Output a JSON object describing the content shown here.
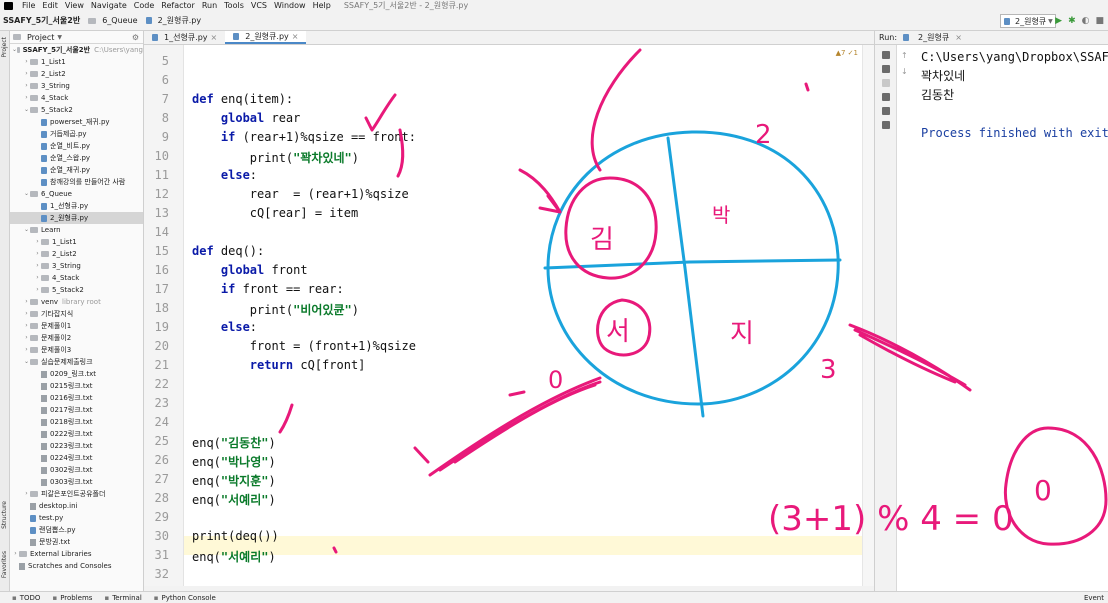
{
  "menubar": {
    "items": [
      "File",
      "Edit",
      "View",
      "Navigate",
      "Code",
      "Refactor",
      "Run",
      "Tools",
      "VCS",
      "Window",
      "Help"
    ],
    "title": "SSAFY_5기_서울2반 - 2_원형큐.py"
  },
  "navbar": {
    "crumbs": [
      "SSAFY_5기_서울2반",
      "6_Queue",
      "2_원형큐.py"
    ],
    "run_config": "2_원형큐"
  },
  "project": {
    "header": "Project",
    "root_name": "SSAFY_5기_서울2반",
    "root_path": "C:\\Users\\yang",
    "rows": [
      {
        "indent": 0,
        "type": "root",
        "label": "SSAFY_5기_서울2반",
        "extra": "C:\\Users\\yang"
      },
      {
        "indent": 1,
        "type": "folder",
        "label": "1_List1"
      },
      {
        "indent": 1,
        "type": "folder",
        "label": "2_List2"
      },
      {
        "indent": 1,
        "type": "folder",
        "label": "3_String"
      },
      {
        "indent": 1,
        "type": "folder",
        "label": "4_Stack"
      },
      {
        "indent": 1,
        "type": "folder-open",
        "label": "5_Stack2"
      },
      {
        "indent": 2,
        "type": "file",
        "label": "powerset_재귀.py"
      },
      {
        "indent": 2,
        "type": "file",
        "label": "거듭제곱.py"
      },
      {
        "indent": 2,
        "type": "file",
        "label": "순열_비트.py"
      },
      {
        "indent": 2,
        "type": "file",
        "label": "순열_스왑.py"
      },
      {
        "indent": 2,
        "type": "file",
        "label": "순열_재귀.py"
      },
      {
        "indent": 2,
        "type": "file",
        "label": "참깨강의를 만들어간 사람"
      },
      {
        "indent": 1,
        "type": "folder-open",
        "label": "6_Queue"
      },
      {
        "indent": 2,
        "type": "file",
        "label": "1_선형큐.py"
      },
      {
        "indent": 2,
        "type": "file",
        "label": "2_원형큐.py",
        "selected": true
      },
      {
        "indent": 1,
        "type": "folder-open",
        "label": "Learn"
      },
      {
        "indent": 2,
        "type": "folder",
        "label": "1_List1"
      },
      {
        "indent": 2,
        "type": "folder",
        "label": "2_List2"
      },
      {
        "indent": 2,
        "type": "folder",
        "label": "3_String"
      },
      {
        "indent": 2,
        "type": "folder",
        "label": "4_Stack"
      },
      {
        "indent": 2,
        "type": "folder",
        "label": "5_Stack2"
      },
      {
        "indent": 1,
        "type": "folder",
        "label": "venv",
        "extra": "library root"
      },
      {
        "indent": 1,
        "type": "folder",
        "label": "기타잡지식"
      },
      {
        "indent": 1,
        "type": "folder",
        "label": "문제풀이1"
      },
      {
        "indent": 1,
        "type": "folder",
        "label": "문제풀이2"
      },
      {
        "indent": 1,
        "type": "folder",
        "label": "문제풀이3"
      },
      {
        "indent": 1,
        "type": "folder-open",
        "label": "실습문제제출링크"
      },
      {
        "indent": 2,
        "type": "txt",
        "label": "0209_링크.txt"
      },
      {
        "indent": 2,
        "type": "txt",
        "label": "0215링크.txt"
      },
      {
        "indent": 2,
        "type": "txt",
        "label": "0216링크.txt"
      },
      {
        "indent": 2,
        "type": "txt",
        "label": "0217링크.txt"
      },
      {
        "indent": 2,
        "type": "txt",
        "label": "0218링크.txt"
      },
      {
        "indent": 2,
        "type": "txt",
        "label": "0222링크.txt"
      },
      {
        "indent": 2,
        "type": "txt",
        "label": "0223링크.txt"
      },
      {
        "indent": 2,
        "type": "txt",
        "label": "0224링크.txt"
      },
      {
        "indent": 2,
        "type": "txt",
        "label": "0302링크.txt"
      },
      {
        "indent": 2,
        "type": "txt",
        "label": "0303링크.txt"
      },
      {
        "indent": 1,
        "type": "folder",
        "label": "피갈은포인트공유폴더"
      },
      {
        "indent": 1,
        "type": "txt",
        "label": "desktop.ini"
      },
      {
        "indent": 1,
        "type": "file",
        "label": "test.py"
      },
      {
        "indent": 1,
        "type": "file",
        "label": "랜덤뽑스.py"
      },
      {
        "indent": 1,
        "type": "txt",
        "label": "문방권.txt"
      },
      {
        "indent": 0,
        "type": "folder",
        "label": "External Libraries"
      },
      {
        "indent": 0,
        "type": "other",
        "label": "Scratches and Consoles"
      }
    ]
  },
  "editor": {
    "tabs": [
      {
        "label": "1_선형큐.py",
        "active": false
      },
      {
        "label": "2_원형큐.py",
        "active": true
      }
    ],
    "inspection": "▲7 ✓1",
    "lines": [
      {
        "n": "5",
        "parts": []
      },
      {
        "n": "6",
        "parts": []
      },
      {
        "n": "7",
        "parts": [
          {
            "t": "def ",
            "c": "kw"
          },
          {
            "t": "enq(item):",
            "c": ""
          }
        ]
      },
      {
        "n": "8",
        "parts": [
          {
            "t": "    global ",
            "c": "kw"
          },
          {
            "t": "rear",
            "c": ""
          }
        ]
      },
      {
        "n": "9",
        "parts": [
          {
            "t": "    if ",
            "c": "kw"
          },
          {
            "t": "(rear+1)%qsize == front:",
            "c": ""
          }
        ]
      },
      {
        "n": "10",
        "parts": [
          {
            "t": "        print(",
            "c": ""
          },
          {
            "t": "\"꽉차있네\"",
            "c": "str"
          },
          {
            "t": ")",
            "c": ""
          }
        ]
      },
      {
        "n": "11",
        "parts": [
          {
            "t": "    else",
            "c": "kw"
          },
          {
            "t": ":",
            "c": ""
          }
        ]
      },
      {
        "n": "12",
        "parts": [
          {
            "t": "        rear  = (rear+1)%qsize",
            "c": ""
          }
        ]
      },
      {
        "n": "13",
        "parts": [
          {
            "t": "        cQ[rear] = item",
            "c": ""
          }
        ]
      },
      {
        "n": "14",
        "parts": []
      },
      {
        "n": "15",
        "parts": [
          {
            "t": "def ",
            "c": "kw"
          },
          {
            "t": "deq():",
            "c": ""
          }
        ]
      },
      {
        "n": "16",
        "parts": [
          {
            "t": "    global ",
            "c": "kw"
          },
          {
            "t": "front",
            "c": ""
          }
        ]
      },
      {
        "n": "17",
        "parts": [
          {
            "t": "    if ",
            "c": "kw"
          },
          {
            "t": "front == rear:",
            "c": ""
          }
        ]
      },
      {
        "n": "18",
        "parts": [
          {
            "t": "        print(",
            "c": ""
          },
          {
            "t": "\"비어있큔\"",
            "c": "str"
          },
          {
            "t": ")",
            "c": ""
          }
        ]
      },
      {
        "n": "19",
        "parts": [
          {
            "t": "    else",
            "c": "kw"
          },
          {
            "t": ":",
            "c": ""
          }
        ]
      },
      {
        "n": "20",
        "parts": [
          {
            "t": "        front = (front+1)%qsize",
            "c": ""
          }
        ]
      },
      {
        "n": "21",
        "parts": [
          {
            "t": "        return ",
            "c": "kw"
          },
          {
            "t": "cQ[front]",
            "c": ""
          }
        ]
      },
      {
        "n": "22",
        "parts": []
      },
      {
        "n": "23",
        "parts": []
      },
      {
        "n": "24",
        "parts": []
      },
      {
        "n": "25",
        "parts": [
          {
            "t": "enq(",
            "c": ""
          },
          {
            "t": "\"김동찬\"",
            "c": "str"
          },
          {
            "t": ")",
            "c": ""
          }
        ]
      },
      {
        "n": "26",
        "parts": [
          {
            "t": "enq(",
            "c": ""
          },
          {
            "t": "\"박나영\"",
            "c": "str"
          },
          {
            "t": ")",
            "c": ""
          }
        ]
      },
      {
        "n": "27",
        "parts": [
          {
            "t": "enq(",
            "c": ""
          },
          {
            "t": "\"박지훈\"",
            "c": "str"
          },
          {
            "t": ")",
            "c": ""
          }
        ]
      },
      {
        "n": "28",
        "parts": [
          {
            "t": "enq(",
            "c": ""
          },
          {
            "t": "\"서예리\"",
            "c": "str"
          },
          {
            "t": ")",
            "c": ""
          }
        ]
      },
      {
        "n": "29",
        "parts": []
      },
      {
        "n": "30",
        "parts": [
          {
            "t": "print(deq())",
            "c": ""
          }
        ]
      },
      {
        "n": "31",
        "parts": [
          {
            "t": "enq(",
            "c": ""
          },
          {
            "t": "\"서예리\"",
            "c": "str"
          },
          {
            "t": ")",
            "c": ""
          }
        ]
      },
      {
        "n": "32",
        "parts": []
      }
    ]
  },
  "run": {
    "label": "Run:",
    "tab": "2_원형큐",
    "output": [
      {
        "text": "C:\\Users\\yang\\Dropbox\\SSAFY\\S",
        "c": ""
      },
      {
        "text": "꽉차있네",
        "c": ""
      },
      {
        "text": "김동찬",
        "c": ""
      },
      {
        "text": "",
        "c": ""
      },
      {
        "text": "Process finished with exit co",
        "c": "blue"
      }
    ]
  },
  "statusbar": {
    "items": [
      "TODO",
      "Problems",
      "Terminal",
      "Python Console"
    ],
    "right": "Event"
  },
  "annotations": {
    "circle_labels": [
      "김",
      "박",
      "서",
      "지"
    ],
    "index_labels": [
      "2",
      "3",
      "0"
    ],
    "formula": "(3+1) % 4 = 0",
    "ink_color": "#e8197a",
    "circle_color": "#1aa3dc"
  }
}
